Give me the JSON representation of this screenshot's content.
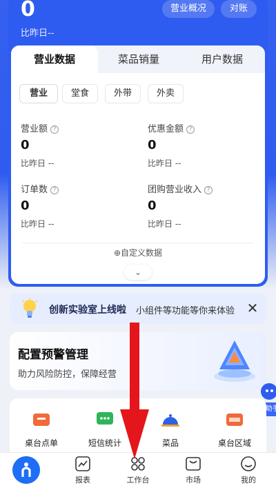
{
  "header": {
    "big_value": "0",
    "yesterday": "比昨日--",
    "overview_button": "营业概况",
    "reconcile_button": "对账"
  },
  "card": {
    "tabs": [
      "营业数据",
      "菜品销量",
      "用户数据"
    ],
    "chips": [
      "营业",
      "堂食",
      "外带",
      "外卖"
    ],
    "metrics": [
      {
        "label": "营业额",
        "value": "0",
        "sub": "比昨日 --"
      },
      {
        "label": "优惠金额",
        "value": "0",
        "sub": "比昨日 --"
      },
      {
        "label": "订单数",
        "value": "0",
        "sub": "比昨日 --"
      },
      {
        "label": "团购营业收入",
        "value": "0",
        "sub": "比昨日 --"
      }
    ],
    "help_glyph": "?",
    "custom_data": "⊕自定义数据",
    "expand": "⌄"
  },
  "banner": {
    "title": "创新实验室上线啦",
    "subtitle": "小组件等功能等你来体验",
    "close": "✕"
  },
  "alert": {
    "title": "配置预警管理",
    "subtitle": "助力风险防控，保障经营"
  },
  "ai": {
    "label": "AI助手"
  },
  "tools": [
    {
      "label": "桌台点单",
      "icon": "table-order-icon",
      "color": "#f06a3a"
    },
    {
      "label": "短信统计",
      "icon": "sms-icon",
      "color": "#2fb45a"
    },
    {
      "label": "菜品",
      "icon": "dish-icon",
      "color": "#2a62e8"
    },
    {
      "label": "桌台区域",
      "icon": "table-area-icon",
      "color": "#f06a3a"
    }
  ],
  "nav": [
    {
      "label": "报表",
      "icon": "report-icon"
    },
    {
      "label": "工作台",
      "icon": "workbench-icon"
    },
    {
      "label": "市场",
      "icon": "market-icon"
    },
    {
      "label": "我的",
      "icon": "profile-icon"
    }
  ],
  "colors": {
    "primary": "#2f5cf0",
    "arrow": "#e4161b"
  }
}
